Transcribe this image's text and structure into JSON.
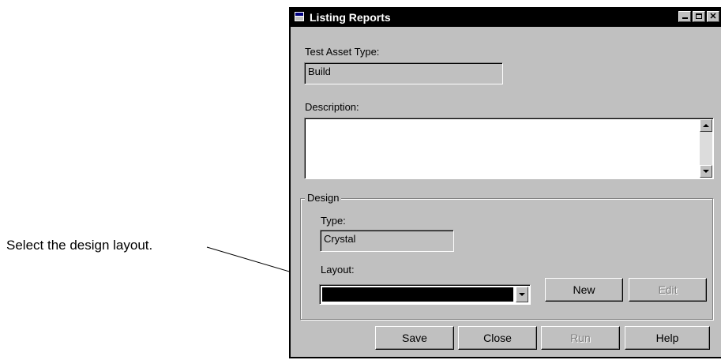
{
  "callout": {
    "text": "Select the design layout."
  },
  "window": {
    "title": "Listing Reports",
    "controls": {
      "minimize": "",
      "maximize": "",
      "close": "✕"
    }
  },
  "form": {
    "test_asset_type": {
      "label": "Test Asset Type:",
      "value": "Build"
    },
    "description": {
      "label": "Description:",
      "value": ""
    },
    "design": {
      "legend": "Design",
      "type": {
        "label": "Type:",
        "value": "Crystal"
      },
      "layout": {
        "label": "Layout:",
        "value": ""
      },
      "new_label": "New",
      "edit_label": "Edit"
    }
  },
  "footer": {
    "save_label": "Save",
    "close_label": "Close",
    "run_label": "Run",
    "help_label": "Help"
  },
  "colors": {
    "dialog_bg": "#c0c0c0",
    "title_bg": "#000000",
    "disabled_text": "#808080"
  }
}
